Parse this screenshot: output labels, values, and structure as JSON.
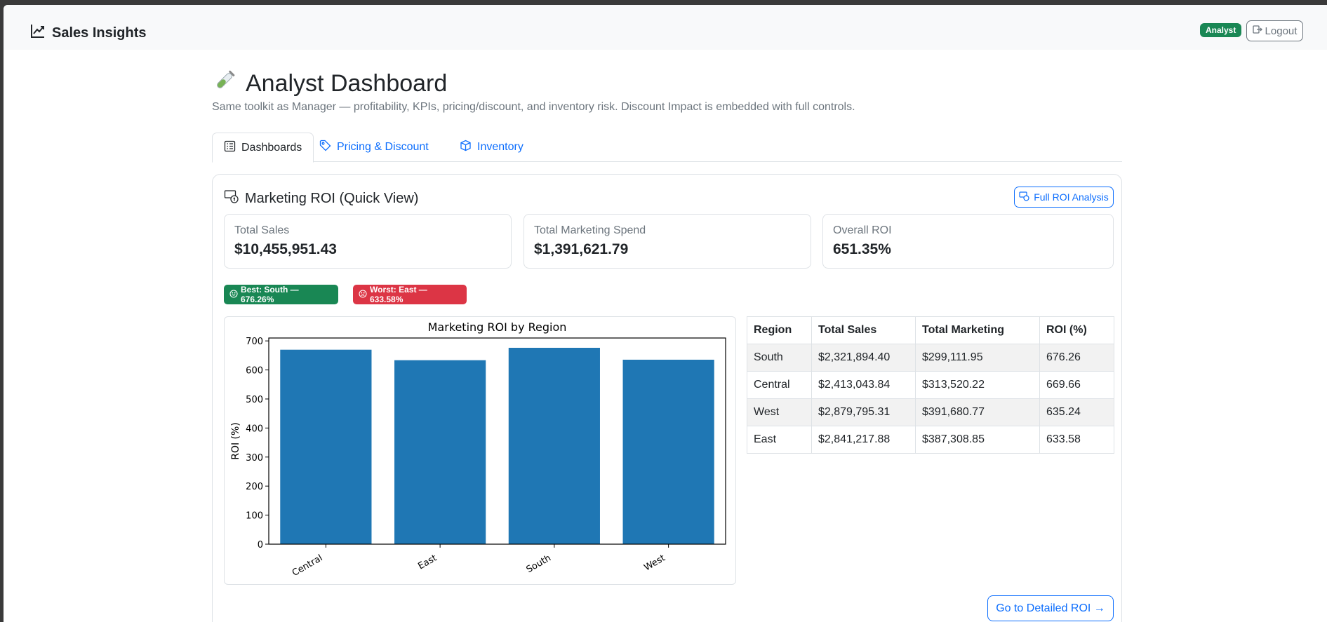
{
  "navbar": {
    "brand": "Sales Insights",
    "role_badge": "Analyst",
    "logout_label": "Logout"
  },
  "page": {
    "title": "Analyst Dashboard",
    "subtitle": "Same toolkit as Manager — profitability, KPIs, pricing/discount, and inventory risk. Discount Impact is embedded with full controls."
  },
  "tabs": [
    {
      "label": "Dashboards",
      "active": true,
      "icon": "list-icon"
    },
    {
      "label": "Pricing & Discount",
      "active": false,
      "icon": "tag-icon"
    },
    {
      "label": "Inventory",
      "active": false,
      "icon": "box-icon"
    }
  ],
  "card": {
    "title": "Marketing ROI (Quick View)",
    "full_roi_label": "Full ROI Analysis",
    "detail_label": "Go to Detailed ROI →"
  },
  "kpis": [
    {
      "label": "Total Sales",
      "value": "$10,455,951.43"
    },
    {
      "label": "Total Marketing Spend",
      "value": "$1,391,621.79"
    },
    {
      "label": "Overall ROI",
      "value": "651.35%"
    }
  ],
  "badges": {
    "best": "Best: South — 676.26%",
    "worst": "Worst: East — 633.58%"
  },
  "table": {
    "headers": [
      "Region",
      "Total Sales",
      "Total Marketing",
      "ROI (%)"
    ],
    "rows": [
      [
        "South",
        "$2,321,894.40",
        "$299,111.95",
        "676.26"
      ],
      [
        "Central",
        "$2,413,043.84",
        "$313,520.22",
        "669.66"
      ],
      [
        "West",
        "$2,879,795.31",
        "$391,680.77",
        "635.24"
      ],
      [
        "East",
        "$2,841,217.88",
        "$387,308.85",
        "633.58"
      ]
    ]
  },
  "colors": {
    "bar": "#1f77b4",
    "primary": "#0d6efd",
    "success": "#198754",
    "danger": "#dc3545"
  },
  "chart_data": {
    "type": "bar",
    "title": "Marketing ROI by Region",
    "xlabel": "",
    "ylabel": "ROI (%)",
    "categories": [
      "Central",
      "East",
      "South",
      "West"
    ],
    "values": [
      669.66,
      633.58,
      676.26,
      635.24
    ],
    "ylim": [
      0,
      710
    ],
    "yticks": [
      0,
      100,
      200,
      300,
      400,
      500,
      600,
      700
    ],
    "grid": false
  }
}
